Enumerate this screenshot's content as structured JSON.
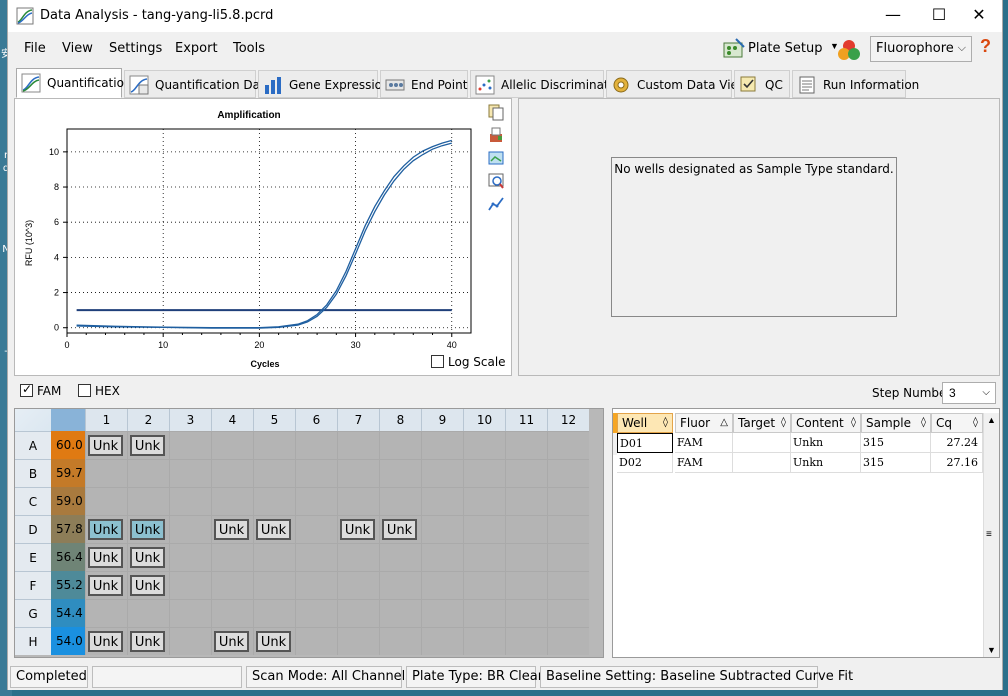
{
  "window": {
    "title": "Data Analysis - tang-yang-li5.8.pcrd",
    "minimize_glyph": "—",
    "maximize_glyph": "☐",
    "close_glyph": "✕"
  },
  "menu": [
    "File",
    "View",
    "Settings",
    "Export",
    "Tools"
  ],
  "toolbar": {
    "plate_setup": "Plate Setup",
    "fluorophore": "Fluorophore",
    "help": "?"
  },
  "tabs": [
    {
      "label": "Quantification",
      "icon": "amplification-curve-icon",
      "active": true
    },
    {
      "label": "Quantification Data",
      "icon": "quantification-data-icon"
    },
    {
      "label": "Gene Expression",
      "icon": "bar-chart-icon"
    },
    {
      "label": "End Point",
      "icon": "end-point-icon"
    },
    {
      "label": "Allelic Discrimination",
      "icon": "scatter-plot-icon"
    },
    {
      "label": "Custom Data View",
      "icon": "gear-icon"
    },
    {
      "label": "QC",
      "icon": "checklist-icon"
    },
    {
      "label": "Run Information",
      "icon": "document-icon"
    }
  ],
  "chart_data": {
    "type": "line",
    "title": "Amplification",
    "xlabel": "Cycles",
    "ylabel": "RFU (10^3)",
    "xlim": [
      0,
      42
    ],
    "ylim": [
      -0.3,
      11.3
    ],
    "xticks": [
      0,
      10,
      20,
      30,
      40
    ],
    "yticks": [
      0,
      2,
      4,
      6,
      8,
      10
    ],
    "grid": true,
    "threshold": 1.0,
    "threshold_color": "#1f3f7a",
    "series_color": "#1f5fa0",
    "series": [
      {
        "x": [
          1,
          5,
          10,
          15,
          20,
          22,
          24,
          25,
          26,
          27,
          28,
          29,
          30,
          31,
          32,
          33,
          34,
          35,
          36,
          37,
          38,
          39,
          40
        ],
        "values": [
          0.15,
          0.08,
          0.03,
          0.0,
          0.0,
          0.05,
          0.2,
          0.4,
          0.75,
          1.3,
          2.1,
          3.2,
          4.5,
          5.8,
          6.9,
          7.8,
          8.6,
          9.2,
          9.7,
          10.05,
          10.3,
          10.5,
          10.65
        ]
      },
      {
        "x": [
          1,
          5,
          10,
          15,
          20,
          22,
          24,
          25,
          26,
          27,
          28,
          29,
          30,
          31,
          32,
          33,
          34,
          35,
          36,
          37,
          38,
          39,
          40
        ],
        "values": [
          0.1,
          0.05,
          0.02,
          -0.02,
          -0.02,
          0.02,
          0.15,
          0.33,
          0.65,
          1.15,
          1.9,
          2.95,
          4.2,
          5.5,
          6.6,
          7.55,
          8.35,
          9.0,
          9.5,
          9.85,
          10.15,
          10.35,
          10.5
        ]
      }
    ]
  },
  "log_scale_label": "Log Scale",
  "standard_curve_message": "No wells designated as Sample Type standard.",
  "fluor_filters": [
    {
      "label": "FAM",
      "checked": true
    },
    {
      "label": "HEX",
      "checked": false
    }
  ],
  "step_number": {
    "label": "Step Number:",
    "value": "3"
  },
  "plate": {
    "columns": [
      "1",
      "2",
      "3",
      "4",
      "5",
      "6",
      "7",
      "8",
      "9",
      "10",
      "11",
      "12"
    ],
    "rows": [
      {
        "label": "A",
        "temp": "60.0",
        "temp_color": "#e07a12",
        "wells": {
          "1": "Unk",
          "2": "Unk"
        }
      },
      {
        "label": "B",
        "temp": "59.7",
        "temp_color": "#c47a28",
        "wells": {}
      },
      {
        "label": "C",
        "temp": "59.0",
        "temp_color": "#a97a3e",
        "wells": {}
      },
      {
        "label": "D",
        "temp": "57.8",
        "temp_color": "#8d7d58",
        "wells": {
          "1": "Unk",
          "2": "Unk",
          "4": "Unk",
          "5": "Unk",
          "7": "Unk",
          "8": "Unk"
        },
        "selected": [
          "1",
          "2"
        ]
      },
      {
        "label": "E",
        "temp": "56.4",
        "temp_color": "#6f8476",
        "wells": {
          "1": "Unk",
          "2": "Unk"
        }
      },
      {
        "label": "F",
        "temp": "55.2",
        "temp_color": "#4e8a99",
        "wells": {
          "1": "Unk",
          "2": "Unk"
        }
      },
      {
        "label": "G",
        "temp": "54.4",
        "temp_color": "#2f8dc0",
        "wells": {}
      },
      {
        "label": "H",
        "temp": "54.0",
        "temp_color": "#1a90e0",
        "wells": {
          "1": "Unk",
          "2": "Unk",
          "4": "Unk",
          "5": "Unk"
        }
      }
    ]
  },
  "table": {
    "headers": [
      "Well",
      "Fluor",
      "Target",
      "Content",
      "Sample",
      "Cq"
    ],
    "sort_glyphs": [
      "◊",
      "△",
      "◊",
      "◊",
      "◊",
      "◊"
    ],
    "rows": [
      {
        "well": "D01",
        "fluor": "FAM",
        "target": "",
        "content": "Unkn",
        "sample": "315",
        "cq": "27.24"
      },
      {
        "well": "D02",
        "fluor": "FAM",
        "target": "",
        "content": "Unkn",
        "sample": "315",
        "cq": "27.16"
      }
    ]
  },
  "status": {
    "state": "Completed",
    "scan_mode": "Scan Mode: All Channels",
    "plate_type": "Plate Type: BR Clear",
    "baseline": "Baseline Setting: Baseline Subtracted Curve Fit"
  },
  "desktop_strip": [
    "r",
    "d",
    "N",
    "安",
    "-"
  ]
}
